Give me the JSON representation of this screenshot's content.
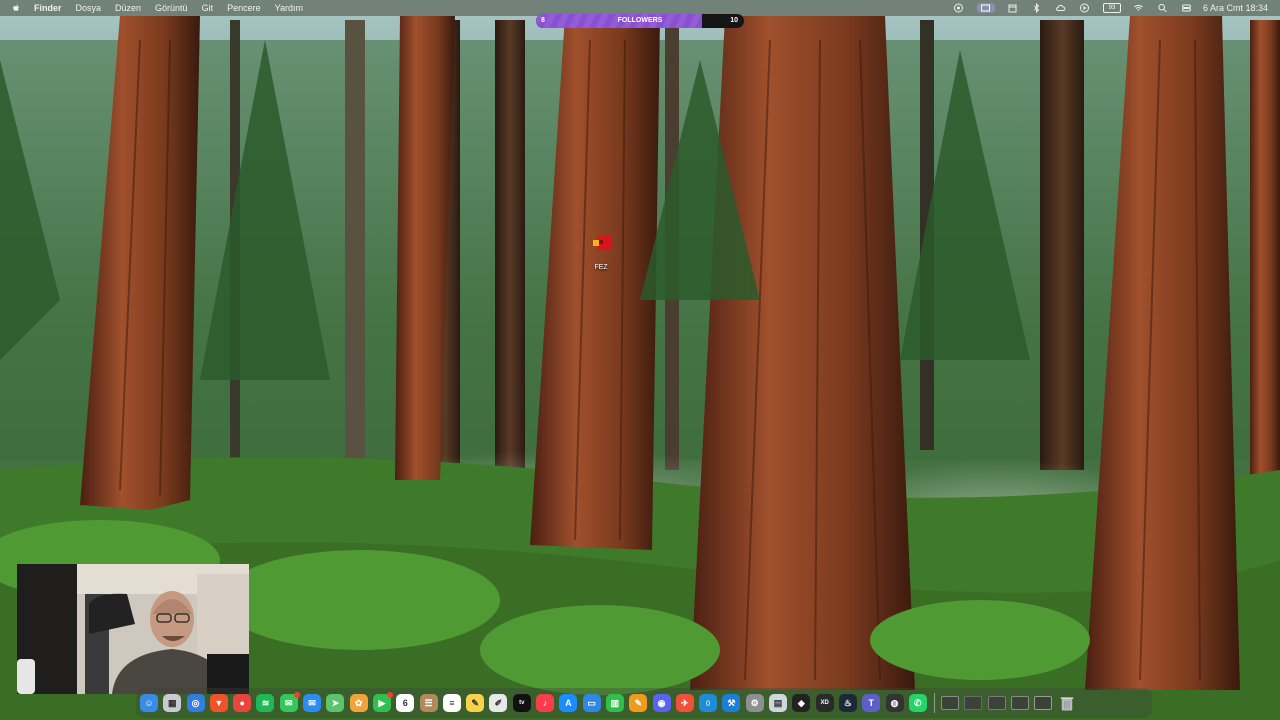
{
  "menubar": {
    "app_name": "Finder",
    "menus": [
      "Dosya",
      "Düzen",
      "Görüntü",
      "Git",
      "Pencere",
      "Yardım"
    ],
    "battery_label": "93",
    "clock": "6 Ara Cmt  18:34"
  },
  "followers_goal": {
    "label": "FOLLOWERS",
    "current": "8",
    "goal": "10",
    "progress": 0.8,
    "fill_color": "#8a4fd2"
  },
  "desktop": {
    "icon_label": "FEZ"
  },
  "dock": {
    "apps": [
      {
        "name": "finder",
        "color": "#3a8be6",
        "glyph": "☺"
      },
      {
        "name": "launchpad",
        "color": "#c9cbd2",
        "glyph": "▦"
      },
      {
        "name": "safari",
        "color": "#2f7fe0",
        "glyph": "◎"
      },
      {
        "name": "brave",
        "color": "#f0522c",
        "glyph": "▼"
      },
      {
        "name": "chrome",
        "color": "#e8453c",
        "glyph": "●"
      },
      {
        "name": "spotify",
        "color": "#1db954",
        "glyph": "≋"
      },
      {
        "name": "messages",
        "color": "#34c759",
        "glyph": "✉"
      },
      {
        "name": "mail",
        "color": "#2d8cf0",
        "glyph": "✉"
      },
      {
        "name": "maps",
        "color": "#5cc46a",
        "glyph": "➤"
      },
      {
        "name": "photos",
        "color": "#f2a33a",
        "glyph": "✿"
      },
      {
        "name": "facetime",
        "color": "#30c04f",
        "glyph": "▶"
      },
      {
        "name": "calendar",
        "color": "#ffffff",
        "glyph": "6"
      },
      {
        "name": "contacts",
        "color": "#b08a5a",
        "glyph": "☰"
      },
      {
        "name": "reminders",
        "color": "#ffffff",
        "glyph": "≡"
      },
      {
        "name": "notes",
        "color": "#f7d34b",
        "glyph": "✎"
      },
      {
        "name": "freeform",
        "color": "#e8e8e8",
        "glyph": "✐"
      },
      {
        "name": "tv",
        "color": "#111111",
        "glyph": "tv"
      },
      {
        "name": "music",
        "color": "#fa3c4c",
        "glyph": "♪"
      },
      {
        "name": "app-store",
        "color": "#1a8cff",
        "glyph": "A"
      },
      {
        "name": "keynote",
        "color": "#2f87e6",
        "glyph": "▭"
      },
      {
        "name": "numbers",
        "color": "#2fbf4a",
        "glyph": "▥"
      },
      {
        "name": "pages",
        "color": "#f39a1e",
        "glyph": "✎"
      },
      {
        "name": "discord",
        "color": "#5865f2",
        "glyph": "◉"
      },
      {
        "name": "swift-playgrounds",
        "color": "#f05138",
        "glyph": "✈"
      },
      {
        "name": "vscode",
        "color": "#1f8ad6",
        "glyph": "⟨⟩"
      },
      {
        "name": "xcode",
        "color": "#1c7ed6",
        "glyph": "⚒"
      },
      {
        "name": "system-settings",
        "color": "#8e8e93",
        "glyph": "⚙"
      },
      {
        "name": "preview",
        "color": "#cfd6e0",
        "glyph": "▤"
      },
      {
        "name": "unity",
        "color": "#222222",
        "glyph": "◆"
      },
      {
        "name": "xd-pen",
        "color": "#2a2a2a",
        "glyph": "XD"
      },
      {
        "name": "steam",
        "color": "#1b2838",
        "glyph": "♨"
      },
      {
        "name": "teams",
        "color": "#5b5fc7",
        "glyph": "T"
      },
      {
        "name": "obs",
        "color": "#333333",
        "glyph": "◍"
      },
      {
        "name": "whatsapp",
        "color": "#25d366",
        "glyph": "✆"
      }
    ],
    "recent": [
      {
        "name": "recent-window-1",
        "color": "#8a8a8a"
      },
      {
        "name": "recent-window-2",
        "color": "#6a6a6a"
      },
      {
        "name": "recent-window-3",
        "color": "#7a7a7a"
      },
      {
        "name": "recent-window-4",
        "color": "#8a8a8a"
      },
      {
        "name": "recent-window-5",
        "color": "#9a9a9a"
      }
    ],
    "trash": {
      "name": "trash",
      "color": "#b9bcc2"
    }
  }
}
